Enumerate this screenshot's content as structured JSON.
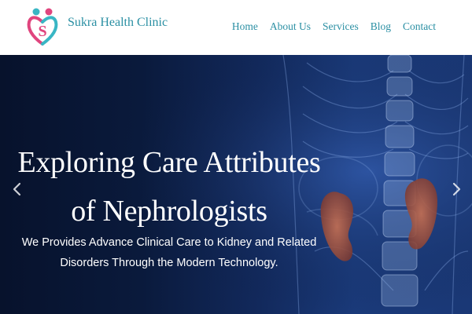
{
  "header": {
    "brand_name": "Sukra Health Clinic",
    "logo_icon": "heart-figures-logo-icon",
    "nav": [
      {
        "label": "Home"
      },
      {
        "label": "About Us"
      },
      {
        "label": "Services"
      },
      {
        "label": "Blog"
      },
      {
        "label": "Contact"
      }
    ]
  },
  "hero": {
    "title_line1": "Exploring Care Attributes",
    "title_line2": "of Nephrologists",
    "subtitle_line1": "We Provides Advance Clinical Care to Kidney and Related",
    "subtitle_line2": "Disorders Through the Modern Technology.",
    "prev_icon": "chevron-left-icon",
    "next_icon": "chevron-right-icon"
  },
  "colors": {
    "brand": "#2a8fa3",
    "hero_dark": "#07122c",
    "hero_blue": "#1a3a7a",
    "kidney": "#b8654a",
    "logo_pink": "#e0457e",
    "logo_teal": "#39b6c4"
  }
}
